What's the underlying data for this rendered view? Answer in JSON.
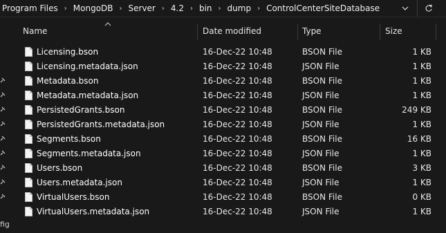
{
  "breadcrumb": [
    {
      "label": "Program Files"
    },
    {
      "label": "MongoDB"
    },
    {
      "label": "Server"
    },
    {
      "label": "4.2"
    },
    {
      "label": "bin"
    },
    {
      "label": "dump"
    },
    {
      "label": "ControlCenterSiteDatabase"
    }
  ],
  "address_icons": {
    "dropdown": "chevron-down-icon",
    "refresh": "refresh-icon"
  },
  "columns": {
    "name": "Name",
    "date": "Date modified",
    "type": "Type",
    "size": "Size"
  },
  "sort": {
    "column": "Name",
    "indicator": "chevron-up-icon"
  },
  "files": [
    {
      "name": "Licensing.bson",
      "date": "16-Dec-22 10:48",
      "type": "BSON File",
      "size": "1 KB"
    },
    {
      "name": "Licensing.metadata.json",
      "date": "16-Dec-22 10:48",
      "type": "JSON File",
      "size": "1 KB"
    },
    {
      "name": "Metadata.bson",
      "date": "16-Dec-22 10:48",
      "type": "BSON File",
      "size": "1 KB"
    },
    {
      "name": "Metadata.metadata.json",
      "date": "16-Dec-22 10:48",
      "type": "JSON File",
      "size": "1 KB"
    },
    {
      "name": "PersistedGrants.bson",
      "date": "16-Dec-22 10:48",
      "type": "BSON File",
      "size": "249 KB"
    },
    {
      "name": "PersistedGrants.metadata.json",
      "date": "16-Dec-22 10:48",
      "type": "JSON File",
      "size": "1 KB"
    },
    {
      "name": "Segments.bson",
      "date": "16-Dec-22 10:48",
      "type": "BSON File",
      "size": "16 KB"
    },
    {
      "name": "Segments.metadata.json",
      "date": "16-Dec-22 10:48",
      "type": "JSON File",
      "size": "1 KB"
    },
    {
      "name": "Users.bson",
      "date": "16-Dec-22 10:48",
      "type": "BSON File",
      "size": "3 KB"
    },
    {
      "name": "Users.metadata.json",
      "date": "16-Dec-22 10:48",
      "type": "JSON File",
      "size": "1 KB"
    },
    {
      "name": "VirtualUsers.bson",
      "date": "16-Dec-22 10:48",
      "type": "BSON File",
      "size": "0 KB"
    },
    {
      "name": "VirtualUsers.metadata.json",
      "date": "16-Dec-22 10:48",
      "type": "JSON File",
      "size": "1 KB"
    }
  ],
  "nav_pane": {
    "pin_icon": "pin-icon",
    "partial_label": "fig"
  },
  "colors": {
    "background": "#191919",
    "text": "#ffffff",
    "divider": "#3c3c3c"
  }
}
